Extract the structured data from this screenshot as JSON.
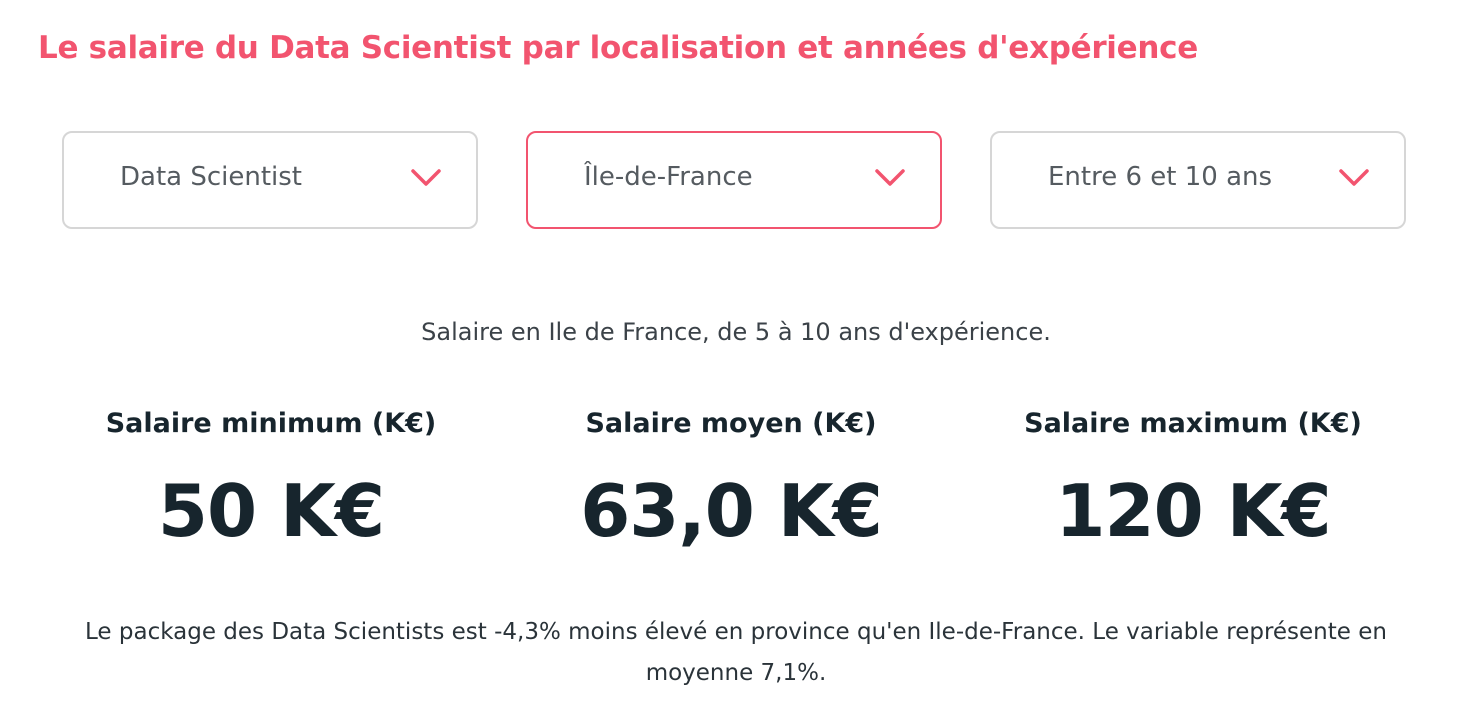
{
  "title": "Le salaire du Data Scientist par localisation et années d'expérience",
  "filters": [
    {
      "value": "Data Scientist",
      "icon": "chevron-down-icon"
    },
    {
      "value": "Île-de-France",
      "icon": "chevron-down-icon"
    },
    {
      "value": "Entre 6 et 10 ans",
      "icon": "chevron-down-icon"
    }
  ],
  "subtitle": "Salaire en Ile de France, de 5 à 10 ans d'expérience.",
  "stats": [
    {
      "label": "Salaire minimum (K€)",
      "value": "50 K€"
    },
    {
      "label": "Salaire moyen (K€)",
      "value": "63,0 K€"
    },
    {
      "label": "Salaire maximum (K€)",
      "value": "120 K€"
    }
  ],
  "footnote": "Le package des Data Scientists est -4,3% moins élevé en province qu'en Ile-de-France. Le variable représente en moyenne 7,1%.",
  "colors": {
    "accent": "#f2546f",
    "text_dark": "#17252d",
    "border": "#d6d6d6"
  }
}
